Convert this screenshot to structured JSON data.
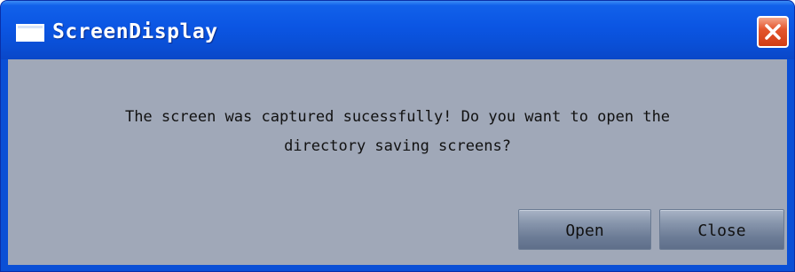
{
  "window": {
    "title": "ScreenDisplay",
    "icons": {
      "app": "window-icon",
      "close": "close-icon"
    },
    "colors": {
      "titlebar": "#0a4fd6",
      "client": "#a0a8b8",
      "close_button": "#e4572e"
    }
  },
  "dialog": {
    "message_line1": "The screen was captured sucessfully! Do you want to open the",
    "message_line2": "directory saving screens?",
    "buttons": {
      "open_label": "Open",
      "close_label": "Close"
    }
  }
}
